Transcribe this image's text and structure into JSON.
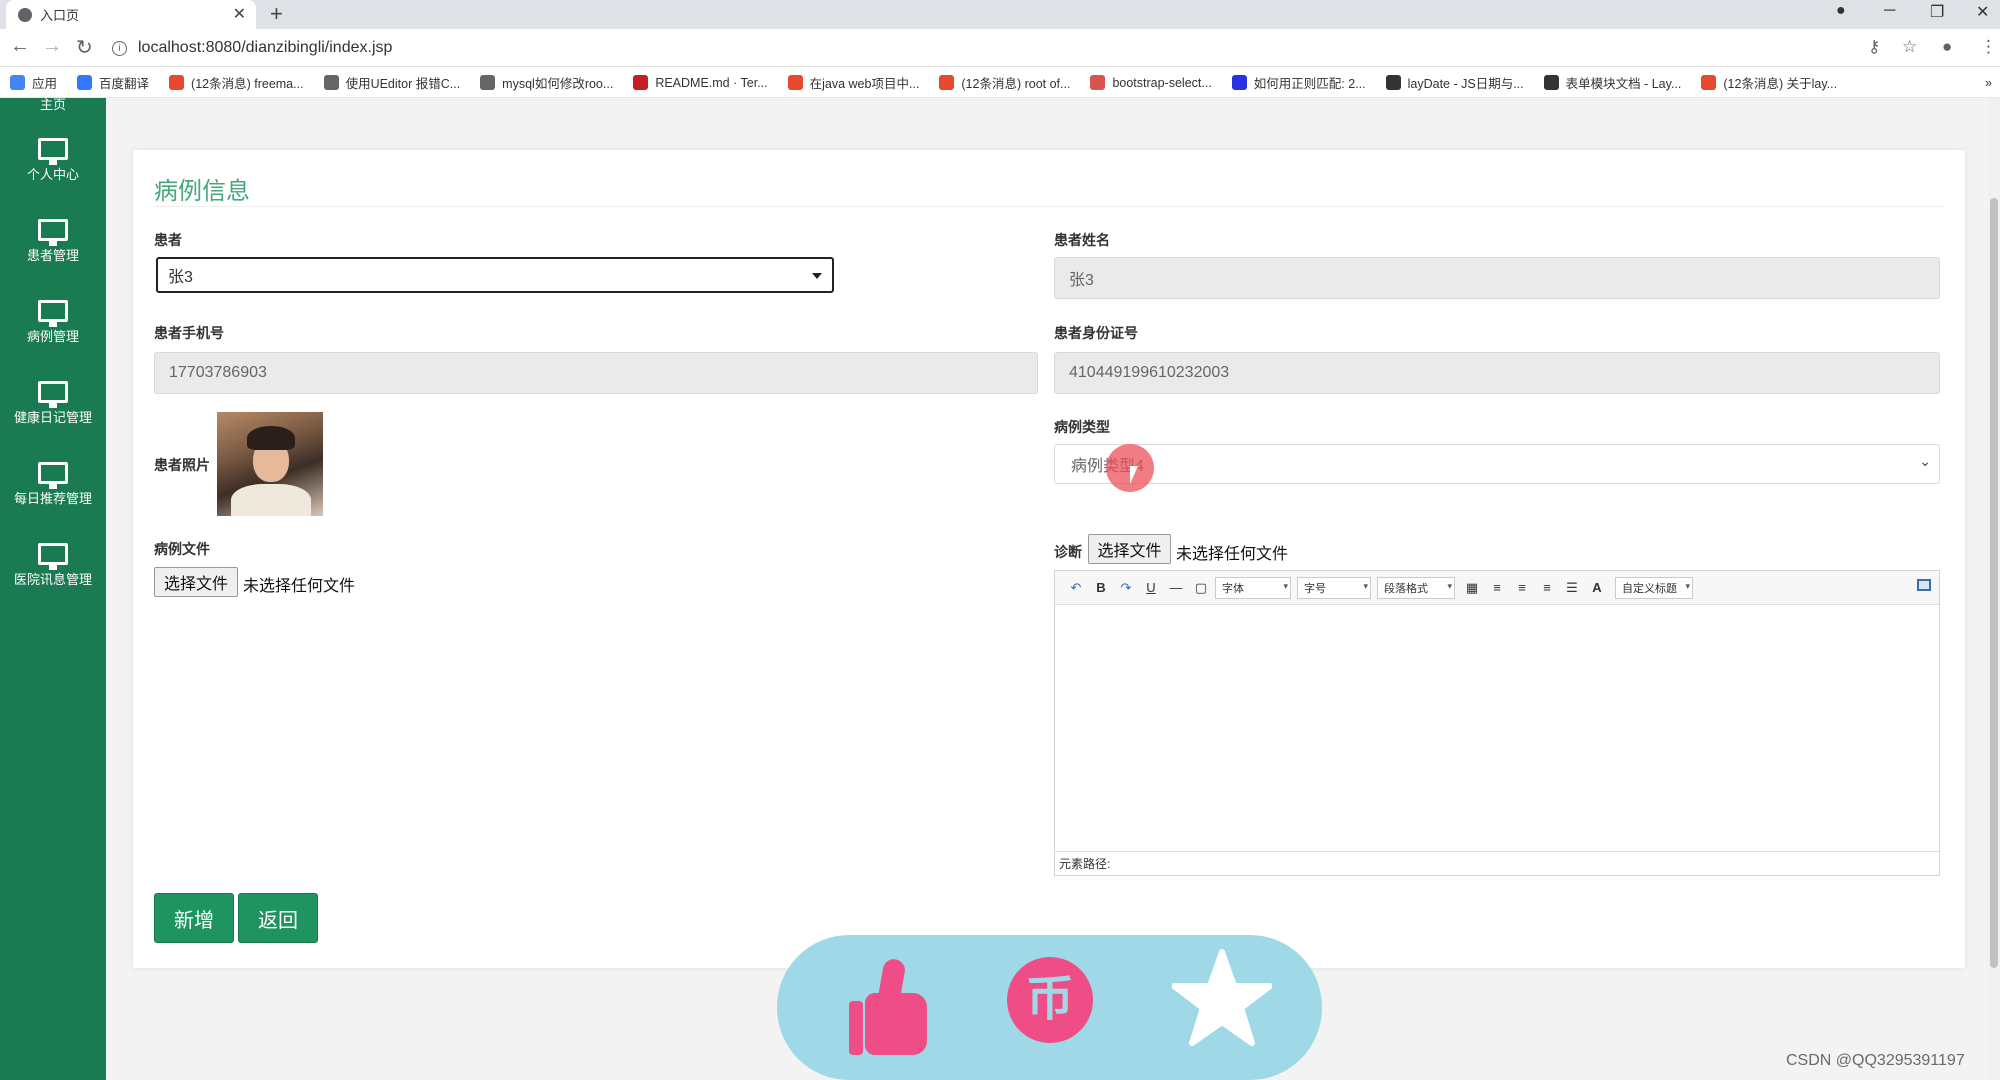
{
  "browser": {
    "tab_title": "入口页",
    "url": "localhost:8080/dianzibingli/index.jsp",
    "bookmarks": [
      {
        "label": "应用",
        "icon": "apps-grid-icon",
        "color": "#4285f4"
      },
      {
        "label": "百度翻译",
        "icon": "baidu-translate-icon",
        "color": "#3377ff"
      },
      {
        "label": "(12条消息) freema...",
        "icon": "csdn-icon",
        "color": "#e8482f"
      },
      {
        "label": "使用UEditor 报错C...",
        "icon": "bookmark-icon",
        "color": "#666666"
      },
      {
        "label": "mysql如何修改roo...",
        "icon": "bookmark-icon",
        "color": "#666666"
      },
      {
        "label": "README.md · Ter...",
        "icon": "gitee-icon",
        "color": "#c71d23"
      },
      {
        "label": "在java web项目中...",
        "icon": "csdn-icon",
        "color": "#e8482f"
      },
      {
        "label": "(12条消息) root of...",
        "icon": "csdn-icon",
        "color": "#e8482f"
      },
      {
        "label": "bootstrap-select...",
        "icon": "bookmark-icon",
        "color": "#d9534f"
      },
      {
        "label": "如何用正则匹配: 2...",
        "icon": "baidu-icon",
        "color": "#2932e1"
      },
      {
        "label": "layDate - JS日期与...",
        "icon": "layui-icon",
        "color": "#333333"
      },
      {
        "label": "表单模块文档 - Lay...",
        "icon": "layui-icon",
        "color": "#333333"
      },
      {
        "label": "(12条消息) 关于lay...",
        "icon": "csdn-icon",
        "color": "#e8482f"
      }
    ]
  },
  "sidebar": {
    "home_label": "主页",
    "items": [
      {
        "label": "个人中心"
      },
      {
        "label": "患者管理"
      },
      {
        "label": "病例管理"
      },
      {
        "label": "健康日记管理"
      },
      {
        "label": "每日推荐管理"
      },
      {
        "label": "医院讯息管理"
      }
    ]
  },
  "form": {
    "title": "病例信息",
    "patient_label": "患者",
    "patient_value": "张3",
    "name_label": "患者姓名",
    "name_value": "张3",
    "phone_label": "患者手机号",
    "phone_value": "17703786903",
    "idcard_label": "患者身份证号",
    "idcard_value": "410449199610232003",
    "photo_label": "患者照片",
    "type_label": "病例类型",
    "type_value": "病例类型4",
    "file_label": "病例文件",
    "choose_file": "选择文件",
    "no_file": "未选择任何文件",
    "diagnosis_label": "诊断",
    "submit_label": "新增",
    "back_label": "返回"
  },
  "editor": {
    "font_label": "字体",
    "size_label": "字号",
    "paragraph_label": "段落格式",
    "custom_title_label": "自定义标题",
    "status_label": "元素路径:"
  },
  "watermark": "CSDN @QQ3295391197",
  "colors": {
    "sidebar": "#1a7a52",
    "title": "#45a77b",
    "button": "#1f9360",
    "overlay": "#9fd9e8",
    "overlay_icons": "#ee4d86"
  }
}
